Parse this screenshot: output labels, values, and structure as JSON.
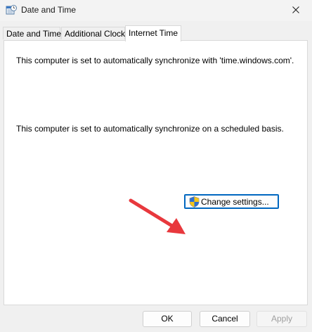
{
  "window": {
    "title": "Date and Time",
    "icon": "clock-calendar-icon",
    "close_icon": "close-icon"
  },
  "tabs": [
    {
      "label": "Date and Time",
      "active": false
    },
    {
      "label": "Additional Clocks",
      "active": false
    },
    {
      "label": "Internet Time",
      "active": true
    }
  ],
  "panel": {
    "sync_server_text": "This computer is set to automatically synchronize with 'time.windows.com'.",
    "sync_schedule_text": "This computer is set to automatically synchronize on a scheduled basis.",
    "change_settings_label": "Change settings...",
    "change_settings_icon": "uac-shield-icon",
    "annotation": "red-arrow-icon"
  },
  "footer": {
    "ok_label": "OK",
    "cancel_label": "Cancel",
    "apply_label": "Apply",
    "apply_enabled": false
  },
  "colors": {
    "accent": "#0067c0",
    "arrow": "#e8383d"
  }
}
